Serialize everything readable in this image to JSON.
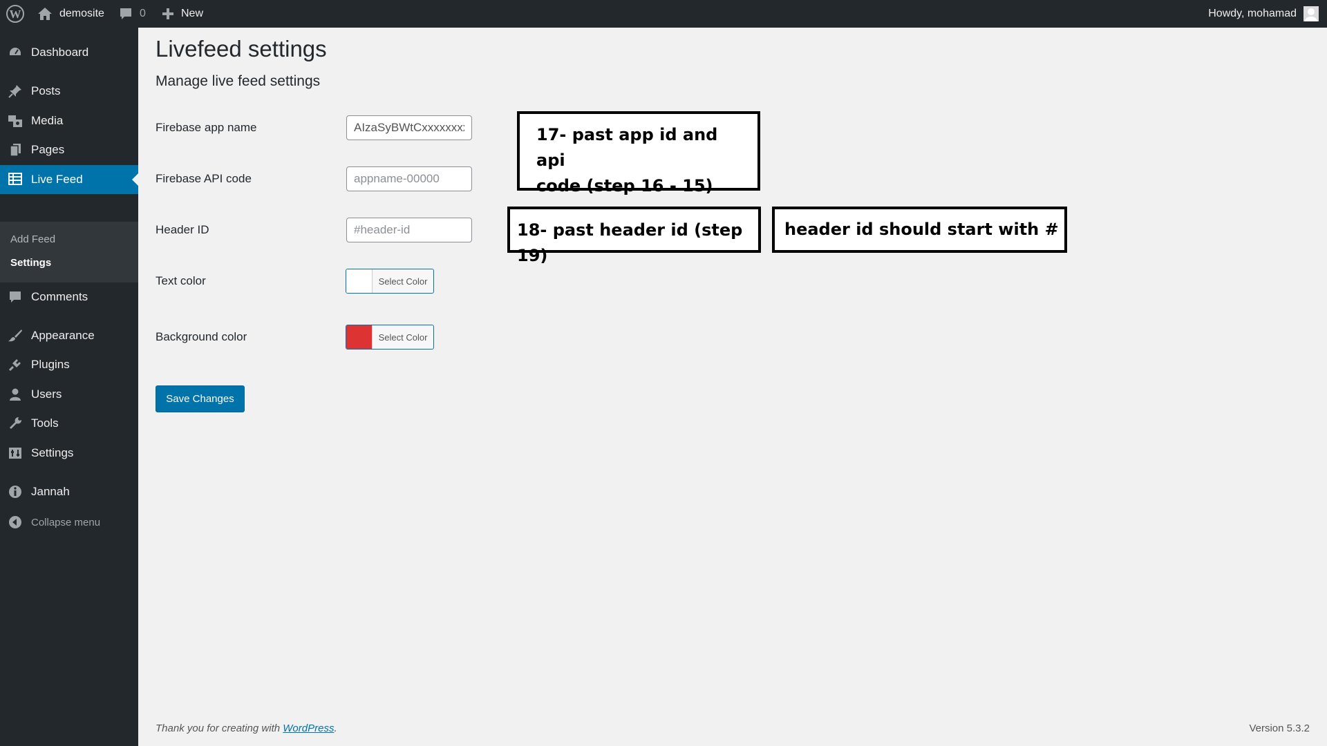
{
  "adminbar": {
    "site_name": "demosite",
    "comments_count": "0",
    "new_label": "New",
    "howdy": "Howdy, mohamad"
  },
  "menu": {
    "dashboard": "Dashboard",
    "posts": "Posts",
    "media": "Media",
    "pages": "Pages",
    "live_feed": "Live Feed",
    "submenu": {
      "add_feed": "Add Feed",
      "settings": "Settings"
    },
    "comments": "Comments",
    "appearance": "Appearance",
    "plugins": "Plugins",
    "users": "Users",
    "tools": "Tools",
    "settings": "Settings",
    "jannah": "Jannah",
    "collapse": "Collapse menu"
  },
  "page": {
    "title": "Livefeed settings",
    "subtitle": "Manage live feed settings"
  },
  "form": {
    "firebase_app_name": {
      "label": "Firebase app name",
      "value": "AIzaSyBWtCxxxxxxxxxxxxxx"
    },
    "firebase_api_code": {
      "label": "Firebase API code",
      "placeholder": "appname-00000"
    },
    "header_id": {
      "label": "Header ID",
      "placeholder": "#header-id"
    },
    "text_color": {
      "label": "Text color",
      "button": "Select Color",
      "color": "#ffffff"
    },
    "background_color": {
      "label": "Background color",
      "button": "Select Color",
      "color": "#dd3333"
    },
    "save_label": "Save Changes"
  },
  "annotations": {
    "note_17_line1": "17- past app id and api",
    "note_17_line2": "code (step 16 - 15)",
    "note_18": "18- past header id (step 19)",
    "note_hash": "header id should start with #"
  },
  "footer": {
    "thanks_prefix": "Thank you for creating with ",
    "thanks_link": "WordPress",
    "thanks_suffix": ".",
    "version": "Version 5.3.2"
  },
  "colors": {
    "adminbar_bg": "#23282d",
    "menu_current": "#0073aa",
    "submenu_bg": "#32373c",
    "primary_button": "#0073aa"
  }
}
